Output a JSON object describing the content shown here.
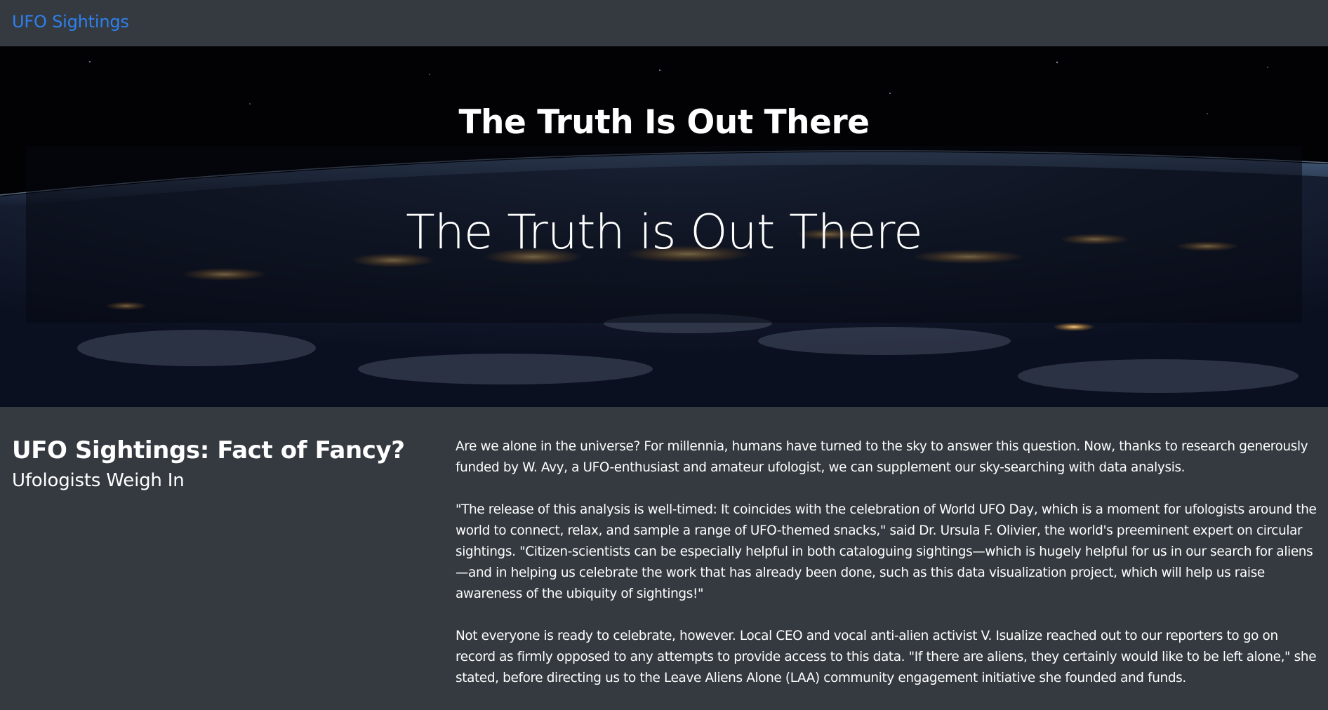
{
  "navbar": {
    "brand": "UFO Sightings"
  },
  "hero": {
    "title": "The Truth Is Out There",
    "jumbotron_title": "The Truth is Out There"
  },
  "article": {
    "title": "UFO Sightings: Fact of Fancy?",
    "subtitle": "Ufologists Weigh In",
    "paragraphs": [
      "Are we alone in the universe? For millennia, humans have turned to the sky to answer this question. Now, thanks to research generously funded by W. Avy, a UFO-enthusiast and amateur ufologist, we can supplement our sky-searching with data analysis.",
      "\"The release of this analysis is well-timed: It coincides with the celebration of World UFO Day, which is a moment for ufologists around the world to connect, relax, and sample a range of UFO-themed snacks,\" said Dr. Ursula F. Olivier, the world's preeminent expert on circular sightings. \"Citizen-scientists can be especially helpful in both cataloguing sightings—which is hugely helpful for us in our search for aliens—and in helping us celebrate the work that has already been done, such as this data visualization project, which will help us raise awareness of the ubiquity of sightings!\"",
      "Not everyone is ready to celebrate, however. Local CEO and vocal anti-alien activist V. Isualize reached out to our reporters to go on record as firmly opposed to any attempts to provide access to this data. \"If there are aliens, they certainly would like to be left alone,\" she stated, before directing us to the Leave Aliens Alone (LAA) community engagement initiative she founded and funds."
    ]
  },
  "colors": {
    "background": "#343a40",
    "brand": "#2f80ed",
    "text": "#ffffff"
  }
}
